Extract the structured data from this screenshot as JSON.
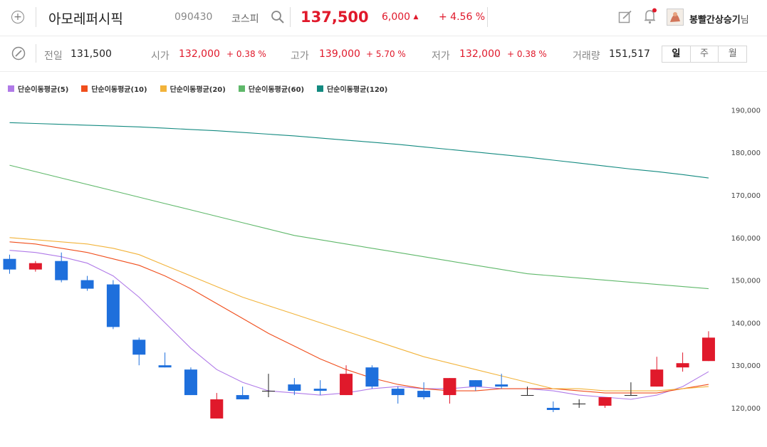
{
  "header": {
    "stock_name": "아모레퍼시픽",
    "stock_code": "090430",
    "market": "코스피",
    "price": "137,500",
    "change": "6,000",
    "change_pct": "+ 4.56 %",
    "user_name": "봉빨간상승기",
    "user_suffix": "님"
  },
  "summary": {
    "prev_label": "전일",
    "prev_value": "131,500",
    "open_label": "시가",
    "open_value": "132,000",
    "open_pct": "+ 0.38 %",
    "high_label": "고가",
    "high_value": "139,000",
    "high_pct": "+ 5.70 %",
    "low_label": "저가",
    "low_value": "132,000",
    "low_pct": "+ 0.38 %",
    "volume_label": "거래량",
    "volume_value": "151,517"
  },
  "period_tabs": [
    "일",
    "주",
    "월"
  ],
  "colors": {
    "up": "#e0192b",
    "down": "#1e6fdc",
    "ma5": "#b07ae8",
    "ma10": "#f04e1c",
    "ma20": "#f2b33a",
    "ma60": "#5fb86a",
    "ma120": "#138a80"
  },
  "chart_data": {
    "type": "candlestick",
    "yaxis_side": "right",
    "ylim": [
      116000,
      192000
    ],
    "y_ticks": [
      120000,
      130000,
      140000,
      150000,
      160000,
      170000,
      180000,
      190000
    ],
    "y_tick_labels": [
      "120,000",
      "130,000",
      "140,000",
      "150,000",
      "160,000",
      "170,000",
      "180,000",
      "190,000"
    ],
    "legend": [
      "단순이동평균(5)",
      "단순이동평균(10)",
      "단순이동평균(20)",
      "단순이동평균(60)",
      "단순이동평균(120)"
    ],
    "candles": [
      {
        "open": 155000,
        "high": 156000,
        "low": 151500,
        "close": 152500
      },
      {
        "open": 152500,
        "high": 154500,
        "low": 152000,
        "close": 154000
      },
      {
        "open": 154500,
        "high": 156500,
        "low": 149500,
        "close": 150000
      },
      {
        "open": 150000,
        "high": 151000,
        "low": 147500,
        "close": 148000
      },
      {
        "open": 149000,
        "high": 150000,
        "low": 138500,
        "close": 139000
      },
      {
        "open": 136000,
        "high": 136500,
        "low": 130000,
        "close": 132500
      },
      {
        "open": 130000,
        "high": 133000,
        "low": 129500,
        "close": 129500
      },
      {
        "open": 129000,
        "high": 129500,
        "low": 123000,
        "close": 123000
      },
      {
        "open": 117500,
        "high": 123500,
        "low": 117500,
        "close": 122000
      },
      {
        "open": 123000,
        "high": 125000,
        "low": 122000,
        "close": 122000
      },
      {
        "open": 124000,
        "high": 128000,
        "low": 122500,
        "close": 124000
      },
      {
        "open": 125500,
        "high": 127000,
        "low": 123000,
        "close": 124000
      },
      {
        "open": 124500,
        "high": 126500,
        "low": 123000,
        "close": 124000
      },
      {
        "open": 123000,
        "high": 130000,
        "low": 123000,
        "close": 128000
      },
      {
        "open": 129500,
        "high": 130000,
        "low": 124500,
        "close": 125000
      },
      {
        "open": 124500,
        "high": 125000,
        "low": 121000,
        "close": 123000
      },
      {
        "open": 124000,
        "high": 126000,
        "low": 122000,
        "close": 122500
      },
      {
        "open": 123000,
        "high": 127000,
        "low": 121000,
        "close": 127000
      },
      {
        "open": 126500,
        "high": 126500,
        "low": 124000,
        "close": 125000
      },
      {
        "open": 125500,
        "high": 128000,
        "low": 124500,
        "close": 125000
      },
      {
        "open": 123000,
        "high": 125000,
        "low": 123000,
        "close": 123000
      },
      {
        "open": 120000,
        "high": 121500,
        "low": 119000,
        "close": 119500
      },
      {
        "open": 121000,
        "high": 122000,
        "low": 120000,
        "close": 121000
      },
      {
        "open": 120500,
        "high": 122500,
        "low": 120000,
        "close": 122500
      },
      {
        "open": 123000,
        "high": 126000,
        "low": 123000,
        "close": 123000
      },
      {
        "open": 125000,
        "high": 132000,
        "low": 125000,
        "close": 129000
      },
      {
        "open": 129500,
        "high": 133000,
        "low": 128500,
        "close": 130500
      },
      {
        "open": 131000,
        "high": 138000,
        "low": 131000,
        "close": 136500
      }
    ],
    "ma": [
      {
        "name": "단순이동평균(5)",
        "color": "#b07ae8",
        "values": [
          157000,
          156500,
          155500,
          154000,
          151000,
          146000,
          140000,
          134000,
          129000,
          126000,
          124000,
          123500,
          123000,
          123500,
          124500,
          125000,
          124500,
          124500,
          125000,
          124500,
          124500,
          124000,
          123000,
          122500,
          122000,
          123000,
          125000,
          128500
        ]
      },
      {
        "name": "단순이동평균(10)",
        "color": "#f04e1c",
        "values": [
          159000,
          158500,
          157500,
          156500,
          155000,
          153500,
          151000,
          148000,
          144500,
          141000,
          137500,
          134500,
          131500,
          129000,
          127000,
          125500,
          124500,
          124000,
          124000,
          124500,
          124500,
          124500,
          124000,
          123500,
          123500,
          123500,
          124500,
          125500
        ]
      },
      {
        "name": "단순이동평균(20)",
        "color": "#f2b33a",
        "values": [
          160000,
          159500,
          159000,
          158500,
          157500,
          156000,
          153500,
          151000,
          148500,
          146000,
          144000,
          142000,
          140000,
          138000,
          136000,
          134000,
          132000,
          130500,
          129000,
          127500,
          126000,
          124500,
          124500,
          124000,
          124000,
          124000,
          124500,
          125000
        ]
      },
      {
        "name": "단순이동평균(60)",
        "color": "#5fb86a",
        "values": [
          177000,
          175500,
          174000,
          172500,
          171000,
          169500,
          168000,
          166500,
          165000,
          163500,
          162000,
          160500,
          159500,
          158500,
          157500,
          156500,
          155500,
          154500,
          153500,
          152500,
          151500,
          151000,
          150500,
          150000,
          149500,
          149000,
          148500,
          148000
        ]
      },
      {
        "name": "단순이동평균(120)",
        "color": "#138a80",
        "values": [
          187000,
          186800,
          186600,
          186400,
          186200,
          186000,
          185700,
          185400,
          185100,
          184700,
          184300,
          183900,
          183400,
          182900,
          182400,
          181900,
          181300,
          180700,
          180100,
          179500,
          178900,
          178200,
          177500,
          176800,
          176100,
          175500,
          174800,
          174000
        ]
      }
    ]
  }
}
